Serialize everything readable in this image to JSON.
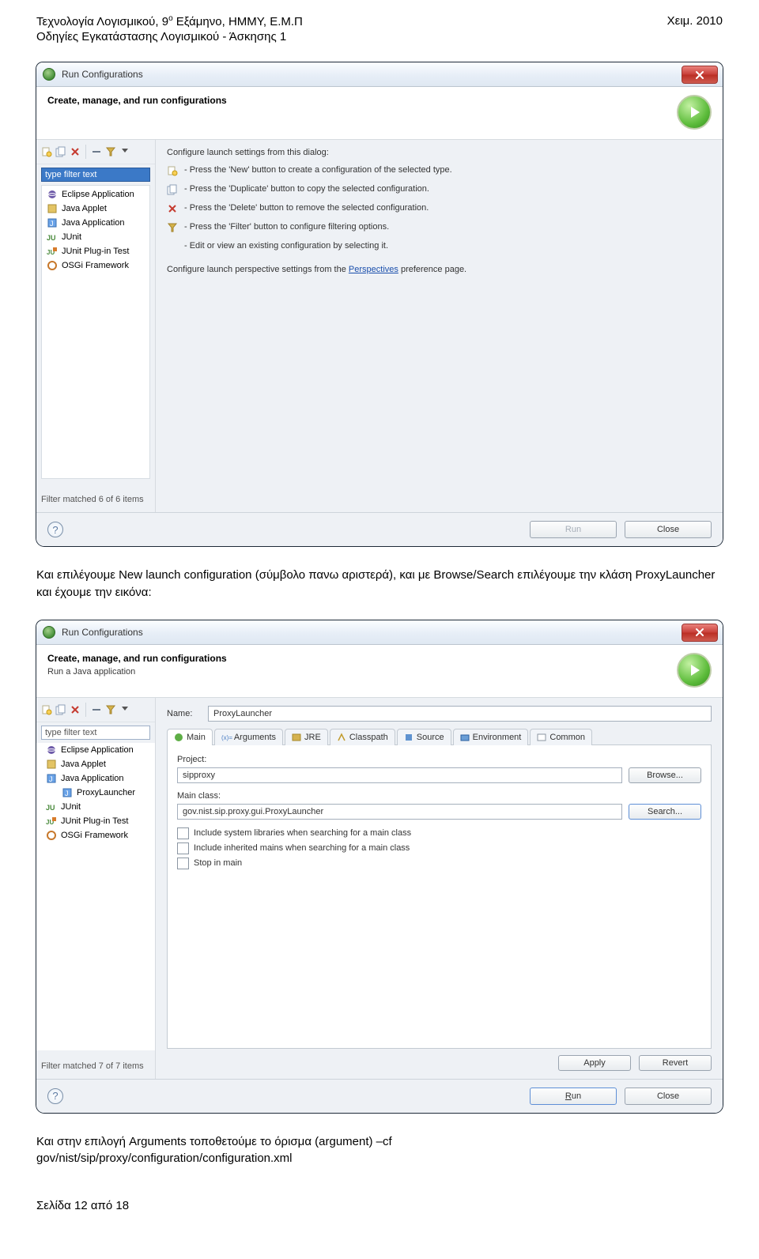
{
  "header": {
    "left1a": "Τεχνολογία Λογισμικού, 9",
    "left1b": " Εξάμηνο, ΗΜΜΥ, Ε.Μ.Π",
    "sup": "ο",
    "left2": "Οδηγίες Εγκατάστασης Λογισμικού - Άσκησης 1",
    "right": "Χειμ. 2010"
  },
  "para1": "Και επιλέγουμε New launch configuration (σύμβολο πανω αριστερά), και με Browse/Search επιλέγουμε την κλάση ProxyLauncher και έχουμε την εικόνα:",
  "para2_a": "Και στην επιλογή Arguments τοποθετούμε το όρισμα (argument) –cf",
  "para2_b": "gov/nist/sip/proxy/configuration/configuration.xml",
  "footer": "Σελίδα 12 από 18",
  "dlg1": {
    "title": "Run Configurations",
    "banner": "Create, manage, and run configurations",
    "right": {
      "intro": "Configure launch settings from this dialog:",
      "i1": "- Press the 'New' button to create a configuration of the selected type.",
      "i2": "- Press the 'Duplicate' button to copy the selected configuration.",
      "i3": "- Press the 'Delete' button to remove the selected configuration.",
      "i4": "- Press the 'Filter' button to configure filtering options.",
      "i5": "- Edit or view an existing configuration by selecting it.",
      "persp_a": "Configure launch perspective settings from the ",
      "persp_link": "Perspectives",
      "persp_b": " preference page."
    },
    "filter": "type filter text",
    "tree": {
      "t0": "Eclipse Application",
      "t1": "Java Applet",
      "t2": "Java Application",
      "t3": "JUnit",
      "t4": "JUnit Plug-in Test",
      "t5": "OSGi Framework"
    },
    "filter_status": "Filter matched 6 of 6 items",
    "btn_run": "Run",
    "btn_close": "Close"
  },
  "dlg2": {
    "title": "Run Configurations",
    "banner": "Create, manage, and run configurations",
    "sub": "Run a Java application",
    "filter": "type filter text",
    "tree": {
      "t0": "Eclipse Application",
      "t1": "Java Applet",
      "t2": "Java Application",
      "t2a": "ProxyLauncher",
      "t3": "JUnit",
      "t4": "JUnit Plug-in Test",
      "t5": "OSGi Framework"
    },
    "filter_status": "Filter matched 7 of 7 items",
    "name_lbl": "Name:",
    "name_val": "ProxyLauncher",
    "tabs": {
      "main": "Main",
      "args": "Arguments",
      "jre": "JRE",
      "cp": "Classpath",
      "src": "Source",
      "env": "Environment",
      "common": "Common"
    },
    "proj_lbl": "Project:",
    "proj_val": "sipproxy",
    "browse": "Browse...",
    "main_lbl": "Main class:",
    "main_val": "gov.nist.sip.proxy.gui.ProxyLauncher",
    "search": "Search...",
    "chk1": "Include system libraries when searching for a main class",
    "chk2": "Include inherited mains when searching for a main class",
    "chk3": "Stop in main",
    "apply": "Apply",
    "revert": "Revert",
    "run": "Run",
    "run_u": "R",
    "close": "Close"
  }
}
